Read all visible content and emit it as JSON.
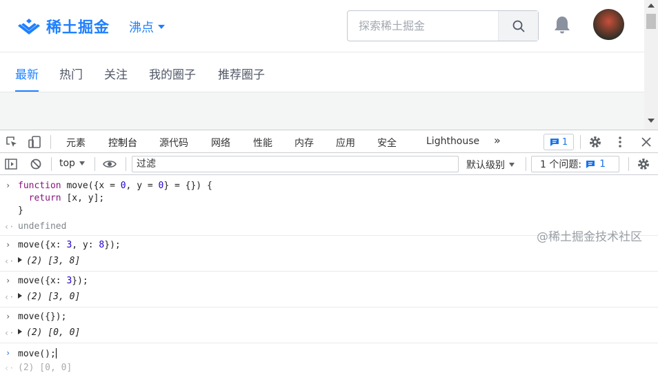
{
  "header": {
    "logo_text": "稀土掘金",
    "nav_label": "沸点",
    "search_placeholder": "探索稀土掘金"
  },
  "subnav": {
    "tabs": [
      {
        "label": "最新",
        "active": true
      },
      {
        "label": "热门",
        "active": false
      },
      {
        "label": "关注",
        "active": false
      },
      {
        "label": "我的圈子",
        "active": false
      },
      {
        "label": "推荐圈子",
        "active": false
      }
    ]
  },
  "devtools": {
    "tabs": [
      "元素",
      "控制台",
      "源代码",
      "网络",
      "性能",
      "内存",
      "应用",
      "安全",
      "Lighthouse"
    ],
    "active_tab": "控制台",
    "more_tabs": "»",
    "issue_badge_count": "1",
    "toolbar": {
      "context": "top",
      "filter_placeholder": "过滤",
      "levels": "默认级别",
      "issues_label": "1 个问题:",
      "issues_count": "1"
    }
  },
  "console": {
    "func_line1": "function move({x = 0, y = 0} = {}) {",
    "func_line2": "  return [x, y];",
    "func_line3": "}",
    "func_result": "undefined",
    "call1": "move({x: 3, y: 8});",
    "result1": "(2) [3, 8]",
    "call2": "move({x: 3});",
    "result2": "(2) [3, 0]",
    "call3": "move({});",
    "result3": "(2) [0, 0]",
    "call4": "move();",
    "result4": "(2) [0, 0]"
  },
  "watermark": "@稀土掘金技术社区",
  "colors": {
    "brand": "#1e80ff",
    "devtools_accent": "#1a73e8"
  }
}
